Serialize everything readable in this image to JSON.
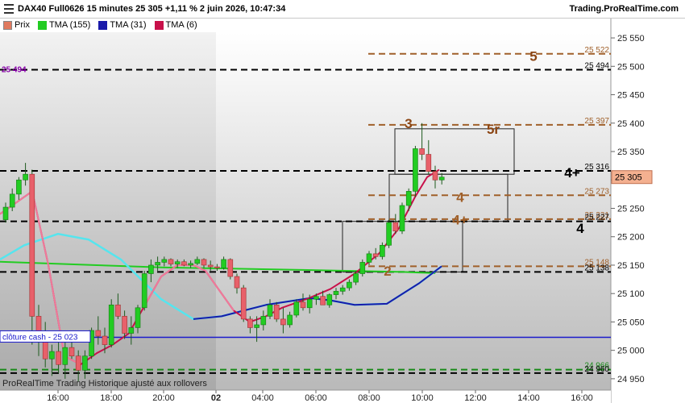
{
  "header": {
    "title": "DAX40 Full0626 15 minutes 25 305 +1,11 % 2 juin 2026, 10:47:34",
    "site": "Trading.ProRealTime.com"
  },
  "legend": [
    {
      "label": "Prix",
      "color": "#e07a5f"
    },
    {
      "label": "TMA (155)",
      "color": "#22cc22"
    },
    {
      "label": "TMA (31)",
      "color": "#1a1aaa"
    },
    {
      "label": "TMA (6)",
      "color": "#c8104a"
    }
  ],
  "left_level_label": "25 494",
  "cash_label": "clôture cash -  25 023",
  "footer": "ProRealTime Trading  Historique ajusté aux rollovers",
  "colors": {
    "up": "#22cc22",
    "down": "#e8606a",
    "tma155": "#22cc22",
    "tma31": "#1a1aaa",
    "tma6": "#c8104a",
    "cyan": "#55e5ee",
    "pink": "#f07a9a",
    "brown": "#a0602a"
  },
  "chart_data": {
    "type": "candlestick",
    "title": "DAX40 Full0626 15 minutes",
    "last_price": "25 305",
    "ylim": [
      24930,
      25560
    ],
    "y_ticks": [
      "24 950",
      "25 000",
      "25 050",
      "25 100",
      "25 150",
      "25 200",
      "25 250",
      "25 300",
      "25 350",
      "25 400",
      "25 450",
      "25 500",
      "25 550"
    ],
    "x_ticks": [
      "16:00",
      "18:00",
      "20:00",
      "02",
      "04:00",
      "06:00",
      "08:00",
      "10:00",
      "12:00",
      "14:00",
      "16:00"
    ],
    "levels": [
      {
        "price": 25522,
        "label": "25 522",
        "style": "brown-dash"
      },
      {
        "price": 25494,
        "label": "25 494",
        "style": "black-dash"
      },
      {
        "price": 25397,
        "label": "25 397",
        "style": "brown-dash"
      },
      {
        "price": 25316,
        "label": "25 316",
        "style": "black-dash"
      },
      {
        "price": 25305,
        "label": "25 305",
        "style": "price"
      },
      {
        "price": 25273,
        "label": "25 273",
        "style": "brown-dash"
      },
      {
        "price": 25231,
        "label": "25 231",
        "style": "brown-dash"
      },
      {
        "price": 25227,
        "label": "25 227",
        "style": "black-dash"
      },
      {
        "price": 25148,
        "label": "25 148",
        "style": "brown-dash"
      },
      {
        "price": 25138,
        "label": "25 138",
        "style": "black-dash"
      },
      {
        "price": 25023,
        "label": "",
        "style": "blue-solid"
      },
      {
        "price": 24966,
        "label": "24 966",
        "style": "green-dash"
      },
      {
        "price": 24960,
        "label": "24 960",
        "style": "black-dash"
      }
    ],
    "zone_labels": [
      {
        "text": "5",
        "price": 25518,
        "color": "#8b4513"
      },
      {
        "text": "3",
        "price": 25400,
        "color": "#8b4513"
      },
      {
        "text": "5r",
        "price": 25390,
        "color": "#8b4513"
      },
      {
        "text": "4+",
        "price": 25313,
        "color": "#000000"
      },
      {
        "text": "4",
        "price": 25270,
        "color": "#a0602a"
      },
      {
        "text": "4+",
        "price": 25230,
        "color": "#a0602a"
      },
      {
        "text": "4",
        "price": 25215,
        "color": "#000000"
      },
      {
        "text": "2",
        "price": 25140,
        "color": "#a0602a"
      }
    ],
    "series": [
      {
        "name": "Prix",
        "ohlc": [
          [
            25230,
            25260,
            25225,
            25252
          ],
          [
            25252,
            25285,
            25245,
            25275
          ],
          [
            25275,
            25305,
            25265,
            25300
          ],
          [
            25300,
            25330,
            25290,
            25310
          ],
          [
            25310,
            25318,
            25010,
            25060
          ],
          [
            25060,
            25080,
            24990,
            25030
          ],
          [
            25030,
            25050,
            24970,
            24985
          ],
          [
            24985,
            25010,
            24955,
            24998
          ],
          [
            24998,
            25020,
            24960,
            24975
          ],
          [
            24975,
            25015,
            24950,
            25005
          ],
          [
            25005,
            25025,
            24985,
            24990
          ],
          [
            24990,
            25000,
            24945,
            24965
          ],
          [
            24965,
            25000,
            24950,
            24990
          ],
          [
            24990,
            25040,
            24985,
            25035
          ],
          [
            25035,
            25060,
            25010,
            25025
          ],
          [
            25025,
            25040,
            24995,
            25010
          ],
          [
            25010,
            25090,
            25005,
            25080
          ],
          [
            25080,
            25100,
            25055,
            25060
          ],
          [
            25060,
            25070,
            25020,
            25030
          ],
          [
            25030,
            25060,
            25010,
            25040
          ],
          [
            25040,
            25080,
            25030,
            25075
          ],
          [
            25075,
            25140,
            25070,
            25135
          ],
          [
            25135,
            25160,
            25120,
            25150
          ],
          [
            25150,
            25165,
            25140,
            25155
          ],
          [
            25155,
            25165,
            25148,
            25160
          ],
          [
            25160,
            25162,
            25148,
            25152
          ],
          [
            25152,
            25160,
            25145,
            25156
          ],
          [
            25156,
            25160,
            25148,
            25150
          ],
          [
            25150,
            25158,
            25145,
            25153
          ],
          [
            25153,
            25165,
            25150,
            25160
          ],
          [
            25160,
            25162,
            25145,
            25150
          ],
          [
            25150,
            25158,
            25140,
            25147
          ],
          [
            25147,
            25152,
            25140,
            25145
          ],
          [
            25145,
            25165,
            25142,
            25160
          ],
          [
            25160,
            25162,
            25125,
            25130
          ],
          [
            25130,
            25135,
            25100,
            25110
          ],
          [
            25110,
            25115,
            25050,
            25055
          ],
          [
            25055,
            25060,
            25030,
            25040
          ],
          [
            25040,
            25060,
            25015,
            25045
          ],
          [
            25045,
            25070,
            25035,
            25060
          ],
          [
            25060,
            25090,
            25055,
            25080
          ],
          [
            25080,
            25085,
            25050,
            25055
          ],
          [
            25055,
            25075,
            25030,
            25045
          ],
          [
            25045,
            25068,
            25040,
            25062
          ],
          [
            25062,
            25090,
            25058,
            25085
          ],
          [
            25085,
            25100,
            25070,
            25075
          ],
          [
            25075,
            25098,
            25065,
            25090
          ],
          [
            25090,
            25100,
            25080,
            25095
          ],
          [
            25095,
            25105,
            25085,
            25080
          ],
          [
            25080,
            25100,
            25075,
            25098
          ],
          [
            25098,
            25110,
            25090,
            25104
          ],
          [
            25104,
            25115,
            25098,
            25110
          ],
          [
            25110,
            25125,
            25105,
            25120
          ],
          [
            25120,
            25140,
            25115,
            25135
          ],
          [
            25135,
            25160,
            25130,
            25155
          ],
          [
            25155,
            25175,
            25150,
            25170
          ],
          [
            25170,
            25180,
            25160,
            25165
          ],
          [
            25165,
            25190,
            25160,
            25185
          ],
          [
            25185,
            25230,
            25180,
            25225
          ],
          [
            25225,
            25240,
            25205,
            25210
          ],
          [
            25210,
            25260,
            25205,
            25255
          ],
          [
            25255,
            25285,
            25245,
            25280
          ],
          [
            25280,
            25360,
            25270,
            25355
          ],
          [
            25355,
            25400,
            25335,
            25345
          ],
          [
            25345,
            25370,
            25310,
            25315
          ],
          [
            25315,
            25325,
            25285,
            25300
          ],
          [
            25300,
            25312,
            25292,
            25305
          ]
        ]
      },
      {
        "name": "TMA (155)"
      },
      {
        "name": "TMA (31)"
      },
      {
        "name": "TMA (6)"
      }
    ]
  }
}
